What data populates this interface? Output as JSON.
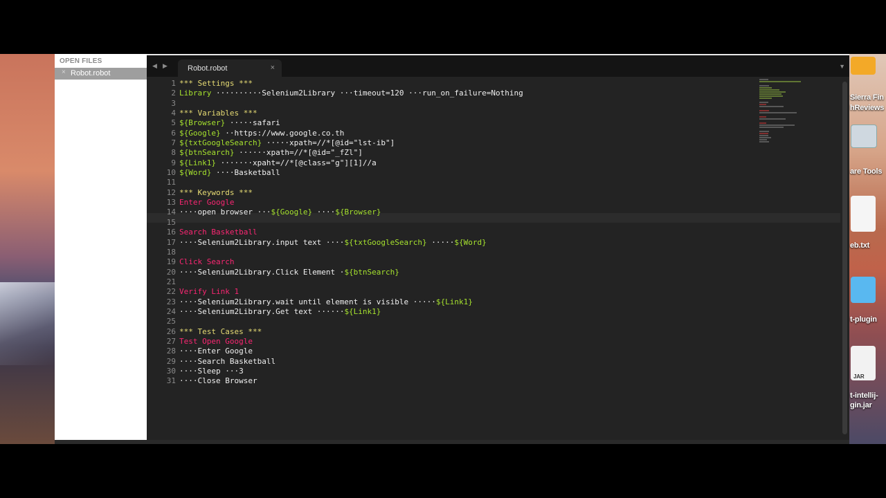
{
  "sidebar": {
    "header": "OPEN FILES",
    "file": "Robot.robot",
    "close_glyph": "×"
  },
  "tab": {
    "name": "Robot.robot",
    "close_glyph": "×"
  },
  "desktop": {
    "labels": [
      "Sierra Fin",
      "hReviews",
      "are Tools",
      "eb.txt",
      "t-plugin",
      "JAR",
      "t-intellij-",
      "gin.jar"
    ]
  },
  "editor": {
    "line_numbers": [
      "1",
      "2",
      "3",
      "4",
      "5",
      "6",
      "7",
      "8",
      "9",
      "10",
      "11",
      "12",
      "13",
      "14",
      "15",
      "16",
      "17",
      "18",
      "19",
      "20",
      "21",
      "22",
      "23",
      "24",
      "25",
      "26",
      "27",
      "28",
      "29",
      "30",
      "31"
    ],
    "lines": [
      [
        [
          "hdr",
          "*** Settings ***"
        ]
      ],
      [
        [
          "kw",
          "Library"
        ],
        [
          "dot",
          " ··········"
        ],
        [
          "txt",
          "Selenium2Library"
        ],
        [
          "dot",
          " ···"
        ],
        [
          "txt",
          "timeout=120"
        ],
        [
          "dot",
          " ···"
        ],
        [
          "txt",
          "run_on_failure=Nothing"
        ]
      ],
      [],
      [
        [
          "hdr",
          "*** Variables ***"
        ]
      ],
      [
        [
          "var",
          "${Browser}"
        ],
        [
          "dot",
          " ·····"
        ],
        [
          "txt",
          "safari"
        ]
      ],
      [
        [
          "var",
          "${Google}"
        ],
        [
          "dot",
          " ··"
        ],
        [
          "txt",
          "https://www.google.co.th"
        ]
      ],
      [
        [
          "var",
          "${txtGoogleSearch}"
        ],
        [
          "dot",
          " ·····"
        ],
        [
          "txt",
          "xpath=//*[@id=\"lst-ib\"]"
        ]
      ],
      [
        [
          "var",
          "${btnSearch}"
        ],
        [
          "dot",
          " ······"
        ],
        [
          "txt",
          "xpath=//*[@id=\"_fZl\"]"
        ]
      ],
      [
        [
          "var",
          "${Link1}"
        ],
        [
          "dot",
          " ·······"
        ],
        [
          "txt",
          "xpaht=//*[@class=\"g\"][1]//a"
        ]
      ],
      [
        [
          "var",
          "${Word}"
        ],
        [
          "dot",
          " ····"
        ],
        [
          "txt",
          "Basketball"
        ]
      ],
      [],
      [
        [
          "hdr",
          "*** Keywords ***"
        ]
      ],
      [
        [
          "name",
          "Enter Google"
        ]
      ],
      [
        [
          "dot",
          "····"
        ],
        [
          "txt",
          "open browser"
        ],
        [
          "dot",
          " ···"
        ],
        [
          "var",
          "${Google}"
        ],
        [
          "dot",
          " ····"
        ],
        [
          "var",
          "${Browser}"
        ]
      ],
      [],
      [
        [
          "name",
          "Search Basketball"
        ]
      ],
      [
        [
          "dot",
          "····"
        ],
        [
          "txt",
          "Selenium2Library.input text"
        ],
        [
          "dot",
          " ····"
        ],
        [
          "var",
          "${txtGoogleSearch}"
        ],
        [
          "dot",
          " ·····"
        ],
        [
          "var",
          "${Word}"
        ]
      ],
      [],
      [
        [
          "name",
          "Click Search"
        ]
      ],
      [
        [
          "dot",
          "····"
        ],
        [
          "txt",
          "Selenium2Library.Click Element"
        ],
        [
          "dot",
          " ·"
        ],
        [
          "var",
          "${btnSearch}"
        ]
      ],
      [],
      [
        [
          "name",
          "Verify Link 1"
        ]
      ],
      [
        [
          "dot",
          "····"
        ],
        [
          "txt",
          "Selenium2Library.wait until element is visible"
        ],
        [
          "dot",
          " ·····"
        ],
        [
          "var",
          "${Link1}"
        ]
      ],
      [
        [
          "dot",
          "····"
        ],
        [
          "txt",
          "Selenium2Library.Get text"
        ],
        [
          "dot",
          " ······"
        ],
        [
          "var",
          "${Link1}"
        ]
      ],
      [],
      [
        [
          "hdr",
          "*** Test Cases ***"
        ]
      ],
      [
        [
          "name",
          "Test Open Google"
        ]
      ],
      [
        [
          "dot",
          "····"
        ],
        [
          "txt",
          "Enter Google"
        ]
      ],
      [
        [
          "dot",
          "····"
        ],
        [
          "txt",
          "Search Basketball"
        ]
      ],
      [
        [
          "dot",
          "····"
        ],
        [
          "txt",
          "Sleep"
        ],
        [
          "dot",
          " ···"
        ],
        [
          "txt",
          "3"
        ]
      ],
      [
        [
          "dot",
          "····"
        ],
        [
          "txt",
          "Close Browser"
        ]
      ]
    ]
  }
}
